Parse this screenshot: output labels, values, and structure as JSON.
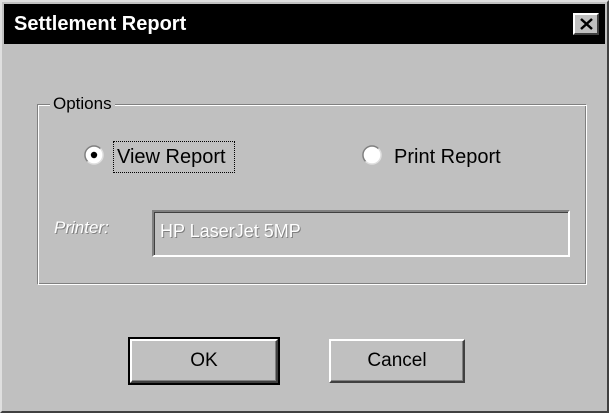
{
  "window": {
    "title": "Settlement Report"
  },
  "options": {
    "legend": "Options",
    "view_report_label": "View Report",
    "view_report_selected": true,
    "print_report_label": "Print Report",
    "print_report_selected": false
  },
  "printer": {
    "label": "Printer:",
    "value": "HP LaserJet 5MP",
    "enabled": false
  },
  "buttons": {
    "ok_label": "OK",
    "cancel_label": "Cancel"
  },
  "icons": {
    "close": "close-icon",
    "radio_selected": "radio-selected-icon",
    "radio_unselected": "radio-unselected-icon"
  }
}
